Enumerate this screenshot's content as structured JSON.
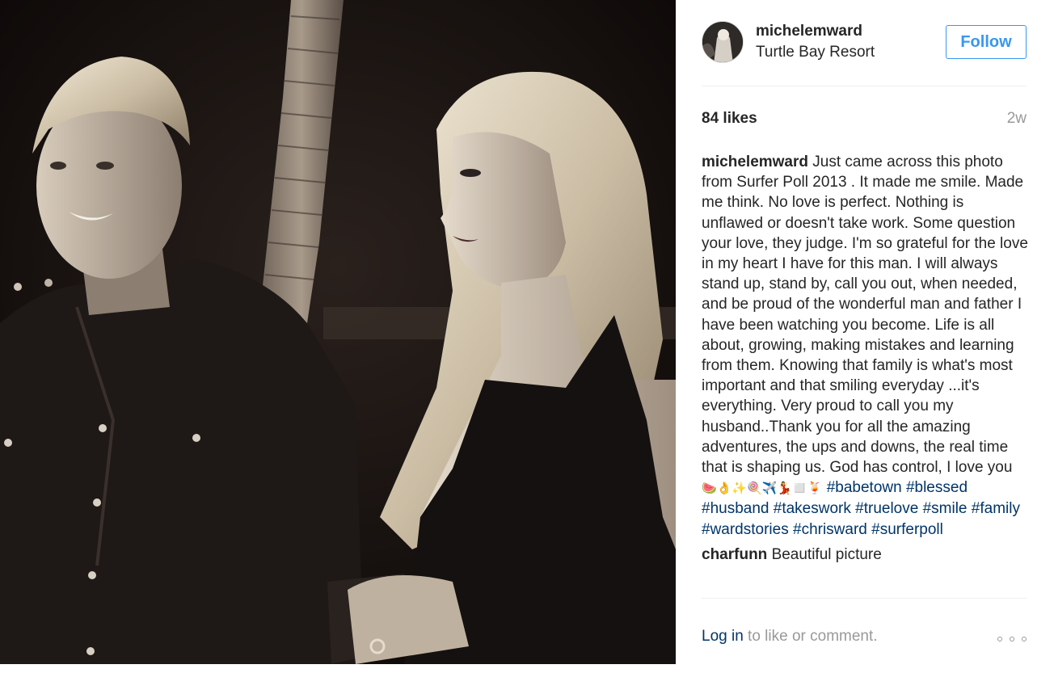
{
  "post": {
    "username": "michelemward",
    "location": "Turtle Bay Resort",
    "follow_label": "Follow",
    "likes": "84 likes",
    "time_ago": "2w"
  },
  "caption": {
    "username": "michelemward",
    "text": "Just came across this photo from Surfer Poll 2013 . It made me smile. Made me think. No love is perfect. Nothing is unflawed or doesn't take work. Some question your love, they judge. I'm so grateful for the love in my heart I have for this man. I will always stand up, stand by, call you out, when needed, and be proud of the wonderful man and father I have been watching you become. Life is all about, growing, making mistakes and learning from them. Knowing that family is what's most important and that smiling everyday ...it's everything. Very proud to call you my husband..Thank you for all the amazing adventures, the ups and downs, the real time that is shaping us. God has control, I love you ",
    "emojis": "🍉👌✨🍭✈️💃◻️🍹",
    "hashtags": [
      "#babetown",
      "#blessed",
      "#husband",
      "#takeswork",
      "#truelove",
      "#smile",
      "#family",
      "#wardstories",
      "#chrisward",
      "#surferpoll"
    ]
  },
  "comments": [
    {
      "username": "charfunn",
      "text": "Beautiful picture"
    }
  ],
  "footer": {
    "login_link": "Log in",
    "login_rest": " to like or comment."
  },
  "colors": {
    "accent": "#3897f0",
    "link": "#003569",
    "muted": "#999999",
    "text": "#262626"
  }
}
